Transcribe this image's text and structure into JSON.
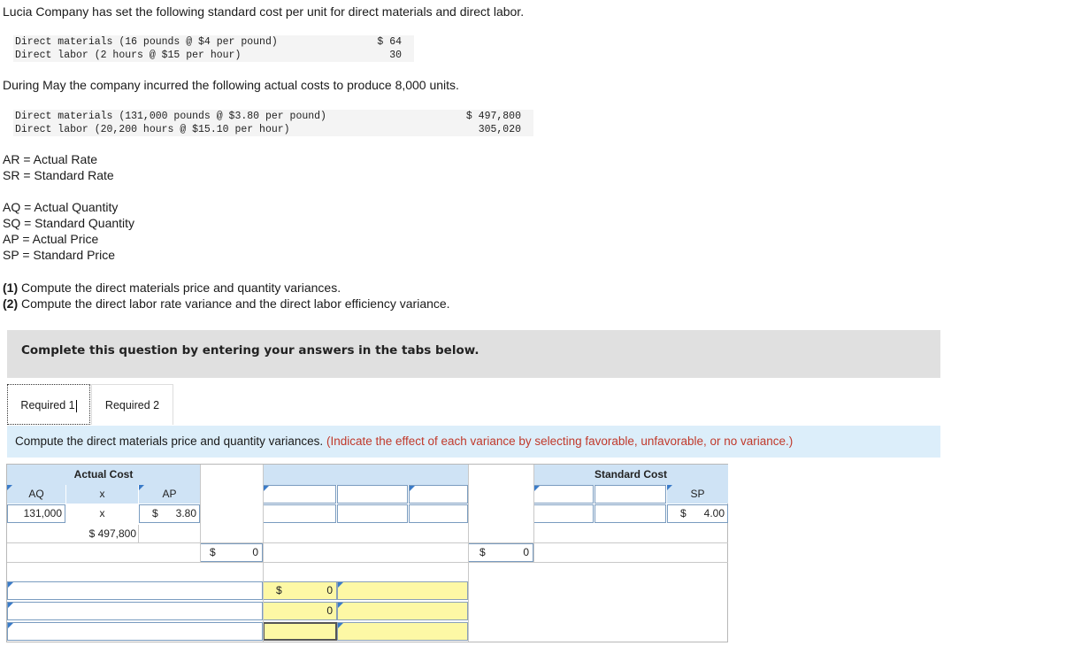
{
  "intro": "Lucia Company has set the following standard cost per unit for direct materials and direct labor.",
  "standard_table": [
    {
      "label": "Direct materials (16 pounds @ $4 per pound)",
      "amount": "$ 64"
    },
    {
      "label": "Direct labor (2 hours @ $15 per hour)",
      "amount": "30"
    }
  ],
  "may_text": "During May the company incurred the following actual costs to produce 8,000 units.",
  "actual_table": [
    {
      "label": "Direct materials (131,000 pounds @ $3.80 per pound)",
      "amount": "$ 497,800"
    },
    {
      "label": "Direct labor (20,200 hours @ $15.10 per hour)",
      "amount": "305,020"
    }
  ],
  "definitions_rate": [
    "AR = Actual Rate",
    "SR = Standard Rate"
  ],
  "definitions_qty": [
    "AQ = Actual Quantity",
    "SQ = Standard Quantity",
    "AP = Actual Price",
    "SP = Standard Price"
  ],
  "requirements": [
    {
      "num": "(1)",
      "text": " Compute the direct materials price and quantity variances."
    },
    {
      "num": "(2)",
      "text": " Compute the direct labor rate variance and the direct labor efficiency variance."
    }
  ],
  "instructions": "Complete this question by entering your answers in the tabs below.",
  "tabs": [
    {
      "label": "Required 1",
      "active": true
    },
    {
      "label": "Required 2",
      "active": false
    }
  ],
  "prompt": {
    "main": "Compute the direct materials price and quantity variances.",
    "note": "(Indicate the effect of each variance by selecting favorable, unfavorable, or no variance.)"
  },
  "worksheet": {
    "actual_cost_header": "Actual Cost",
    "standard_cost_header": "Standard Cost",
    "aq_label": "AQ",
    "times": "x",
    "ap_label": "AP",
    "sp_label": "SP",
    "aq_value": "131,000",
    "ap_dollar": "$",
    "ap_value": "3.80",
    "sp_dollar": "$",
    "sp_value": "4.00",
    "actual_total": "$ 497,800",
    "col2_dollar": "$",
    "col2_total": "0",
    "col3_dollar": "$",
    "col3_total": "0",
    "variance_dollar": "$",
    "variance1_value": "0",
    "variance2_value": "0"
  }
}
